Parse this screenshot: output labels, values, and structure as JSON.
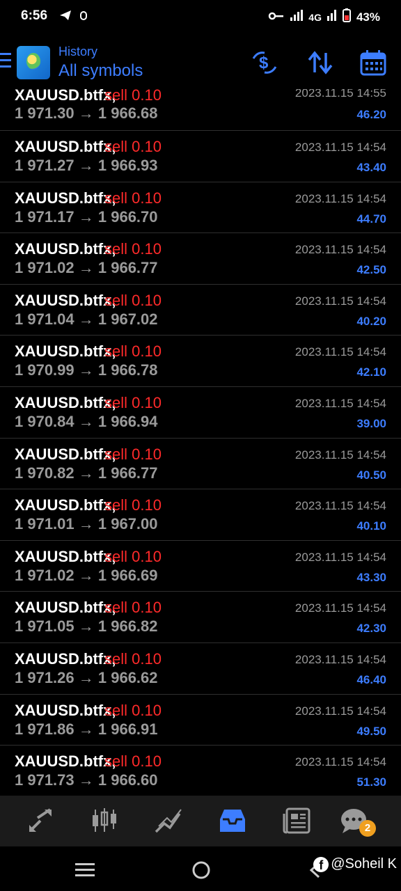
{
  "status_bar": {
    "time": "6:56",
    "network": "4G",
    "battery": "43%"
  },
  "header": {
    "subtitle": "History",
    "title": "All symbols"
  },
  "trades": [
    {
      "symbol": "XAUUSD.btfx,",
      "side": "sell 0.10",
      "open": "1 971.30",
      "close": "1 966.68",
      "date": "2023.11.15 14:55",
      "profit": "46.20"
    },
    {
      "symbol": "XAUUSD.btfx,",
      "side": "sell 0.10",
      "open": "1 971.27",
      "close": "1 966.93",
      "date": "2023.11.15 14:54",
      "profit": "43.40"
    },
    {
      "symbol": "XAUUSD.btfx,",
      "side": "sell 0.10",
      "open": "1 971.17",
      "close": "1 966.70",
      "date": "2023.11.15 14:54",
      "profit": "44.70"
    },
    {
      "symbol": "XAUUSD.btfx,",
      "side": "sell 0.10",
      "open": "1 971.02",
      "close": "1 966.77",
      "date": "2023.11.15 14:54",
      "profit": "42.50"
    },
    {
      "symbol": "XAUUSD.btfx,",
      "side": "sell 0.10",
      "open": "1 971.04",
      "close": "1 967.02",
      "date": "2023.11.15 14:54",
      "profit": "40.20"
    },
    {
      "symbol": "XAUUSD.btfx,",
      "side": "sell 0.10",
      "open": "1 970.99",
      "close": "1 966.78",
      "date": "2023.11.15 14:54",
      "profit": "42.10"
    },
    {
      "symbol": "XAUUSD.btfx,",
      "side": "sell 0.10",
      "open": "1 970.84",
      "close": "1 966.94",
      "date": "2023.11.15 14:54",
      "profit": "39.00"
    },
    {
      "symbol": "XAUUSD.btfx,",
      "side": "sell 0.10",
      "open": "1 970.82",
      "close": "1 966.77",
      "date": "2023.11.15 14:54",
      "profit": "40.50"
    },
    {
      "symbol": "XAUUSD.btfx,",
      "side": "sell 0.10",
      "open": "1 971.01",
      "close": "1 967.00",
      "date": "2023.11.15 14:54",
      "profit": "40.10"
    },
    {
      "symbol": "XAUUSD.btfx,",
      "side": "sell 0.10",
      "open": "1 971.02",
      "close": "1 966.69",
      "date": "2023.11.15 14:54",
      "profit": "43.30"
    },
    {
      "symbol": "XAUUSD.btfx,",
      "side": "sell 0.10",
      "open": "1 971.05",
      "close": "1 966.82",
      "date": "2023.11.15 14:54",
      "profit": "42.30"
    },
    {
      "symbol": "XAUUSD.btfx,",
      "side": "sell 0.10",
      "open": "1 971.26",
      "close": "1 966.62",
      "date": "2023.11.15 14:54",
      "profit": "46.40"
    },
    {
      "symbol": "XAUUSD.btfx,",
      "side": "sell 0.10",
      "open": "1 971.86",
      "close": "1 966.91",
      "date": "2023.11.15 14:54",
      "profit": "49.50"
    },
    {
      "symbol": "XAUUSD.btfx,",
      "side": "sell 0.10",
      "open": "1 971.73",
      "close": "1 966.60",
      "date": "2023.11.15 14:54",
      "profit": "51.30"
    }
  ],
  "bottom_nav": {
    "items": [
      "quotes-icon",
      "chart-icon",
      "trade-icon",
      "history-icon",
      "news-icon",
      "chat-icon"
    ],
    "active": "history-icon",
    "chat_badge": "2"
  },
  "watermark": {
    "text": "@Soheil K"
  },
  "colors": {
    "accent": "#3d7dff",
    "sell": "#ff2a2a",
    "muted": "#9a9a9a",
    "badge": "#f0a020"
  }
}
